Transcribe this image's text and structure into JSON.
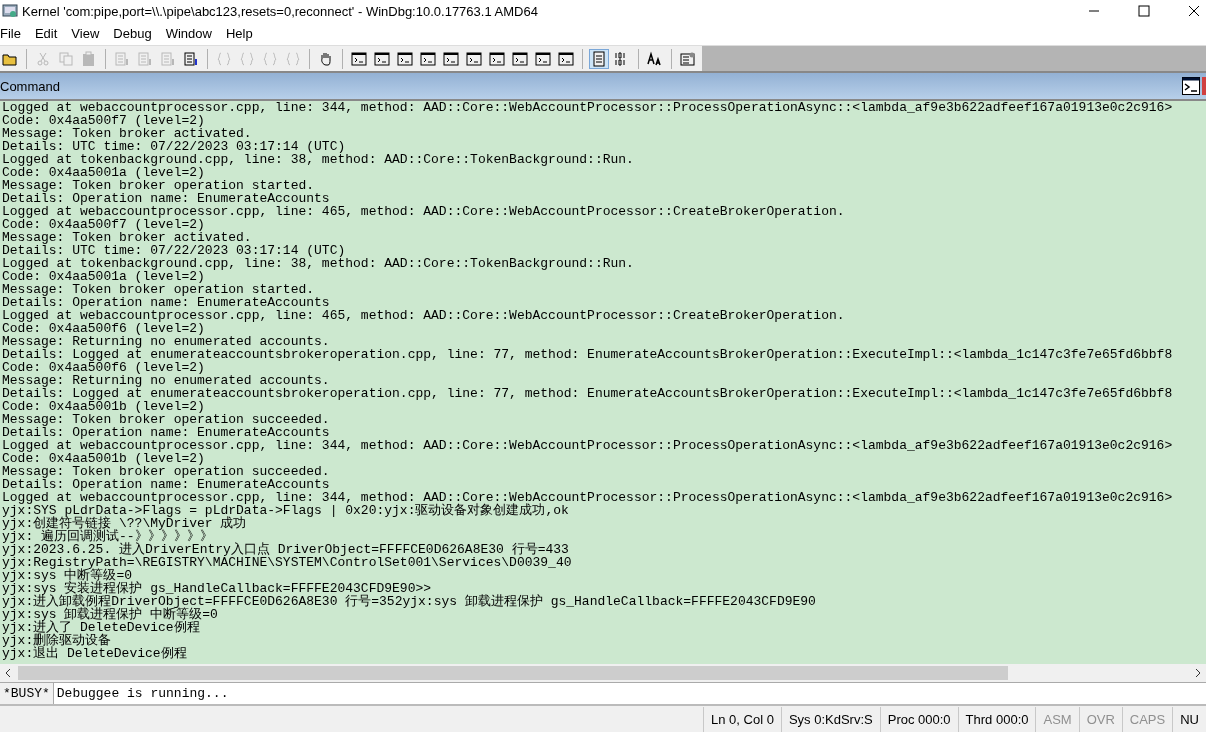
{
  "window": {
    "title": "Kernel 'com:pipe,port=\\\\.\\pipe\\abc123,resets=0,reconnect' - WinDbg:10.0.17763.1 AMD64"
  },
  "menu": [
    "File",
    "Edit",
    "View",
    "Debug",
    "Window",
    "Help"
  ],
  "toolbar": [
    {
      "kind": "folder",
      "disabled": false
    },
    {
      "kind": "sep"
    },
    {
      "kind": "scissors",
      "disabled": true
    },
    {
      "kind": "copy",
      "disabled": true
    },
    {
      "kind": "paste",
      "disabled": true
    },
    {
      "kind": "sep"
    },
    {
      "kind": "lines",
      "disabled": true
    },
    {
      "kind": "lines",
      "disabled": true
    },
    {
      "kind": "lines",
      "disabled": true
    },
    {
      "kind": "lines",
      "disabled": false
    },
    {
      "kind": "sep"
    },
    {
      "kind": "brace",
      "disabled": true
    },
    {
      "kind": "brace",
      "disabled": true
    },
    {
      "kind": "brace",
      "disabled": true
    },
    {
      "kind": "brace",
      "disabled": true
    },
    {
      "kind": "sep"
    },
    {
      "kind": "hand",
      "disabled": false
    },
    {
      "kind": "sep"
    },
    {
      "kind": "window",
      "disabled": false
    },
    {
      "kind": "window",
      "disabled": false
    },
    {
      "kind": "window",
      "disabled": false
    },
    {
      "kind": "window",
      "disabled": false
    },
    {
      "kind": "window",
      "disabled": false
    },
    {
      "kind": "window",
      "disabled": false
    },
    {
      "kind": "window",
      "disabled": false
    },
    {
      "kind": "window",
      "disabled": false
    },
    {
      "kind": "window",
      "disabled": false
    },
    {
      "kind": "window",
      "disabled": false
    },
    {
      "kind": "sep"
    },
    {
      "kind": "page",
      "disabled": false,
      "selected": true
    },
    {
      "kind": "binary",
      "disabled": false
    },
    {
      "kind": "sep"
    },
    {
      "kind": "font",
      "disabled": false
    },
    {
      "kind": "sep"
    },
    {
      "kind": "options",
      "disabled": false
    }
  ],
  "command_pane": {
    "title": "Command",
    "lines": [
      "Logged at webaccountprocessor.cpp, line: 344, method: AAD::Core::WebAccountProcessor::ProcessOperationAsync::<lambda_af9e3b622adfeef167a01913e0c2c916>",
      "Code: 0x4aa500f7 (level=2)",
      "Message: Token broker activated.",
      "Details: UTC time: 07/22/2023 03:17:14 (UTC)",
      "Logged at tokenbackground.cpp, line: 38, method: AAD::Core::TokenBackground::Run.",
      "Code: 0x4aa5001a (level=2)",
      "Message: Token broker operation started.",
      "Details: Operation name: EnumerateAccounts",
      "Logged at webaccountprocessor.cpp, line: 465, method: AAD::Core::WebAccountProcessor::CreateBrokerOperation.",
      "Code: 0x4aa500f7 (level=2)",
      "Message: Token broker activated.",
      "Details: UTC time: 07/22/2023 03:17:14 (UTC)",
      "Logged at tokenbackground.cpp, line: 38, method: AAD::Core::TokenBackground::Run.",
      "Code: 0x4aa5001a (level=2)",
      "Message: Token broker operation started.",
      "Details: Operation name: EnumerateAccounts",
      "Logged at webaccountprocessor.cpp, line: 465, method: AAD::Core::WebAccountProcessor::CreateBrokerOperation.",
      "Code: 0x4aa500f6 (level=2)",
      "Message: Returning no enumerated accounts.",
      "Details: Logged at enumerateaccountsbrokeroperation.cpp, line: 77, method: EnumerateAccountsBrokerOperation::ExecuteImpl::<lambda_1c147c3fe7e65fd6bbf8",
      "Code: 0x4aa500f6 (level=2)",
      "Message: Returning no enumerated accounts.",
      "Details: Logged at enumerateaccountsbrokeroperation.cpp, line: 77, method: EnumerateAccountsBrokerOperation::ExecuteImpl::<lambda_1c147c3fe7e65fd6bbf8",
      "Code: 0x4aa5001b (level=2)",
      "Message: Token broker operation succeeded.",
      "Details: Operation name: EnumerateAccounts",
      "Logged at webaccountprocessor.cpp, line: 344, method: AAD::Core::WebAccountProcessor::ProcessOperationAsync::<lambda_af9e3b622adfeef167a01913e0c2c916>",
      "Code: 0x4aa5001b (level=2)",
      "Message: Token broker operation succeeded.",
      "Details: Operation name: EnumerateAccounts",
      "Logged at webaccountprocessor.cpp, line: 344, method: AAD::Core::WebAccountProcessor::ProcessOperationAsync::<lambda_af9e3b622adfeef167a01913e0c2c916>",
      "yjx:SYS pLdrData->Flags = pLdrData->Flags | 0x20:yjx:驱动设备对象创建成功,ok",
      "yjx:创建符号链接 \\??\\MyDriver 成功",
      "yjx: 遍历回调测试--》》》》》》",
      "yjx:2023.6.25. 进入DriverEntry入口点 DriverObject=FFFFCE0D626A8E30 行号=433",
      "yjx:RegistryPath=\\REGISTRY\\MACHINE\\SYSTEM\\ControlSet001\\Services\\D0039_40",
      "yjx:sys 中断等级=0",
      "yjx:sys 安装进程保护 gs_HandleCallback=FFFFE2043CFD9E90>>",
      "yjx:进入卸载例程DriverObject=FFFFCE0D626A8E30 行号=352yjx:sys 卸载进程保护 gs_HandleCallback=FFFFE2043CFD9E90",
      "yjx:sys 卸载进程保护 中断等级=0",
      "yjx:进入了 DeleteDevice例程",
      "yjx:删除驱动设备",
      "yjx:退出 DeleteDevice例程"
    ],
    "prompt": "*BUSY*",
    "input_value": "Debuggee is running..."
  },
  "status_bar": [
    {
      "text": "Ln 0, Col 0",
      "disabled": false
    },
    {
      "text": "Sys 0:KdSrv:S",
      "disabled": false
    },
    {
      "text": "Proc 000:0",
      "disabled": false
    },
    {
      "text": "Thrd 000:0",
      "disabled": false
    },
    {
      "text": "ASM",
      "disabled": true
    },
    {
      "text": "OVR",
      "disabled": true
    },
    {
      "text": "CAPS",
      "disabled": true
    },
    {
      "text": "NU",
      "disabled": false
    }
  ]
}
